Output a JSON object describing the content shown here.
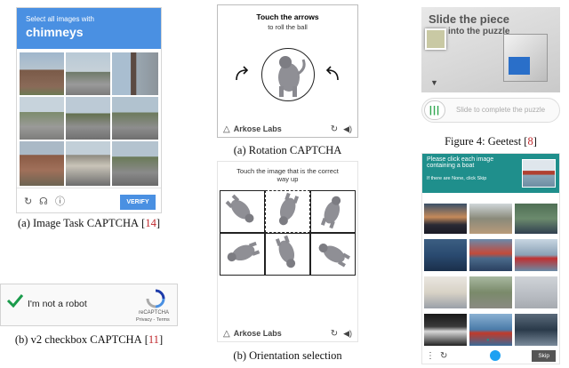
{
  "image_task": {
    "instruction": "Select all images with",
    "target": "chimneys",
    "verify_label": "VERIFY",
    "caption_prefix": "(a) Image Task ",
    "caption_cap": "CAPTCHA",
    "caption_ref": "14"
  },
  "checkbox": {
    "label": "I'm not a robot",
    "brand": "reCAPTCHA",
    "links": "Privacy - Terms",
    "caption_prefix": "(b) v2 checkbox ",
    "caption_cap": "CAPTCHA",
    "caption_ref": "11"
  },
  "rotation": {
    "title": "Touch the arrows",
    "subtitle": "to roll the ball",
    "brand": "Arkose Labs",
    "caption_prefix": "(a) Rotation ",
    "caption_cap": "CAPTCHA"
  },
  "orientation": {
    "instruction": "Touch the image that is the correct way up",
    "brand": "Arkose Labs",
    "caption": "(b) Orientation selection"
  },
  "geetest": {
    "title_line1": "Slide the piece",
    "title_line2": "into the puzzle",
    "slider_text": "Slide to complete the puzzle",
    "caption_prefix": "Figure 4: Geetest [",
    "caption_ref": "8",
    "caption_suffix": "]"
  },
  "image_select": {
    "line1": "Please click each image",
    "line2": "containing a boat",
    "line3": "If there are None, click Skip",
    "skip_label": "Skip"
  },
  "colors": {
    "recaptcha_blue": "#4a90e2",
    "geetest_green": "#32a852",
    "teal": "#1f8f8c",
    "citation_red": "#c0282c"
  }
}
